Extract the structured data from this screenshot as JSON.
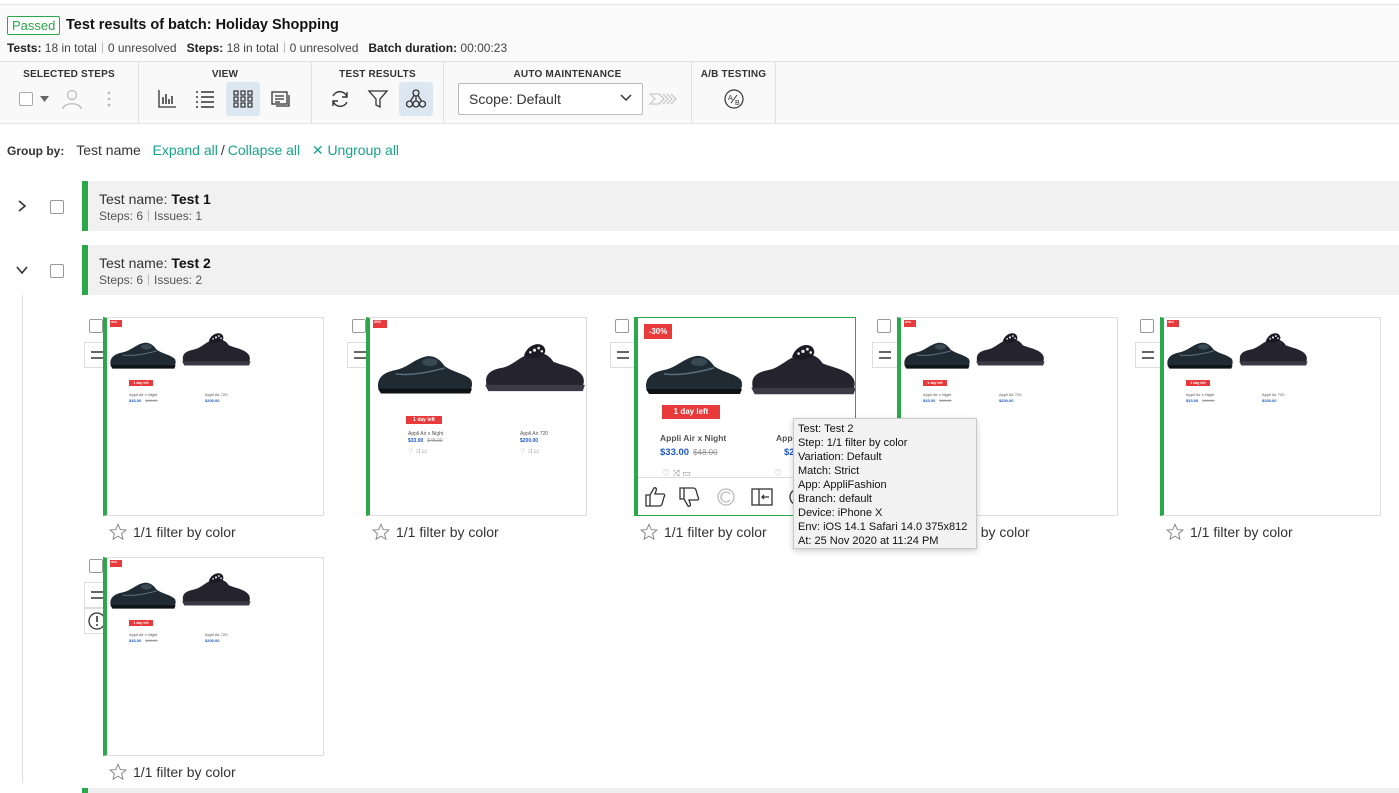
{
  "header": {
    "status": "Passed",
    "title": "Test results of batch: Holiday Shopping",
    "tests_label": "Tests:",
    "tests_total": "18 in total",
    "tests_unresolved": "0 unresolved",
    "steps_label": "Steps:",
    "steps_total": "18 in total",
    "steps_unresolved": "0 unresolved",
    "duration_label": "Batch duration:",
    "duration": "00:00:23"
  },
  "toolbar": {
    "selected_steps": "SELECTED STEPS",
    "view": "VIEW",
    "test_results": "TEST RESULTS",
    "auto_maintenance": "AUTO MAINTENANCE",
    "ab_testing": "A/B TESTING",
    "scope": "Scope: Default"
  },
  "groupby": {
    "label": "Group by:",
    "value": "Test name",
    "expand_all": "Expand all",
    "slash": "/",
    "collapse_all": "Collapse all",
    "ungroup_all": "Ungroup all"
  },
  "groups": [
    {
      "prefix": "Test name:",
      "name": "Test 1",
      "steps": "Steps: 6",
      "issues": "Issues: 1"
    },
    {
      "prefix": "Test name:",
      "name": "Test 2",
      "steps": "Steps: 6",
      "issues": "Issues: 2"
    }
  ],
  "cards": [
    {
      "label": "1/1 filter by color"
    },
    {
      "label": "1/1 filter by color"
    },
    {
      "label": "1/1 filter by color"
    },
    {
      "label": "1/1 filter by color"
    },
    {
      "label": "1/1 filter by color"
    },
    {
      "label": "1/1 filter by color"
    }
  ],
  "thumb": {
    "sale": "-30%",
    "days_left": "1 day left",
    "product1_name": "Appli Air x Night",
    "product1_price": "$33.00",
    "product1_old": "$48.00",
    "product2_name": "Appli Air 720",
    "product2_price": "$200.00",
    "product2_name_short": "Appl",
    "product2_price_short": "$2"
  },
  "tooltip": {
    "test": "Test: Test 2",
    "step": "Step: 1/1 filter by color",
    "variation": "Variation: Default",
    "match": "Match: Strict",
    "app": "App: AppliFashion",
    "branch": "Branch: default",
    "device": "Device: iPhone X",
    "env": "Env: iOS 14.1 Safari 14.0 375x812",
    "at": "At: 25 Nov 2020 at 11:24 PM"
  },
  "colors": {
    "accent": "#19a38b",
    "passed": "#2aa84a",
    "sale": "#e8393b",
    "price": "#1e59c8"
  }
}
